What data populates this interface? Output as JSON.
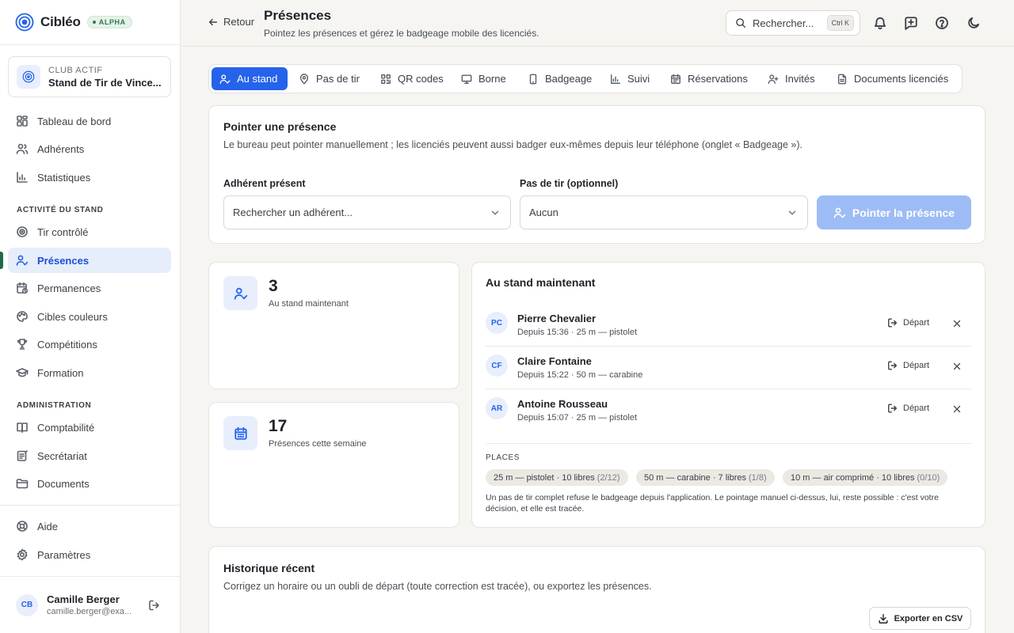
{
  "brand": {
    "name": "Cibléo",
    "badge": "ALPHA"
  },
  "club": {
    "label": "CLUB ACTIF",
    "name": "Stand de Tir de Vince..."
  },
  "sidebar": {
    "main": [
      {
        "label": "Tableau de bord",
        "icon": "dashboard-icon"
      },
      {
        "label": "Adhérents",
        "icon": "users-icon"
      },
      {
        "label": "Statistiques",
        "icon": "chart-icon"
      }
    ],
    "section_stand": "ACTIVITÉ DU STAND",
    "stand": [
      {
        "label": "Tir contrôlé",
        "icon": "target-icon"
      },
      {
        "label": "Présences",
        "icon": "user-check-icon",
        "active": true
      },
      {
        "label": "Permanences",
        "icon": "calendar-clock-icon"
      },
      {
        "label": "Cibles couleurs",
        "icon": "palette-icon"
      },
      {
        "label": "Compétitions",
        "icon": "trophy-icon"
      },
      {
        "label": "Formation",
        "icon": "graduation-cap-icon"
      }
    ],
    "section_admin": "ADMINISTRATION",
    "admin": [
      {
        "label": "Comptabilité",
        "icon": "ledger-icon"
      },
      {
        "label": "Secrétariat",
        "icon": "notepad-icon"
      },
      {
        "label": "Documents",
        "icon": "folder-icon"
      }
    ],
    "bottom": [
      {
        "label": "Aide",
        "icon": "lifebuoy-icon"
      },
      {
        "label": "Paramètres",
        "icon": "gear-icon"
      }
    ]
  },
  "user": {
    "initials": "CB",
    "name": "Camille Berger",
    "email": "camille.berger@exa..."
  },
  "header": {
    "back_label": "Retour",
    "title": "Présences",
    "subtitle": "Pointez les présences et gérez le badgeage mobile des licenciés.",
    "search_label": "Rechercher...",
    "search_shortcut": "Ctrl K"
  },
  "tabs": [
    {
      "label": "Au stand",
      "icon": "user-check-icon",
      "active": true
    },
    {
      "label": "Pas de tir",
      "icon": "map-pin-icon"
    },
    {
      "label": "QR codes",
      "icon": "qr-code-icon"
    },
    {
      "label": "Borne",
      "icon": "monitor-icon"
    },
    {
      "label": "Badgeage",
      "icon": "smartphone-icon"
    },
    {
      "label": "Suivi",
      "icon": "bar-chart-icon"
    },
    {
      "label": "Réservations",
      "icon": "calendar-icon"
    },
    {
      "label": "Invités",
      "icon": "user-plus-icon"
    },
    {
      "label": "Documents licenciés",
      "icon": "file-icon"
    }
  ],
  "pointer": {
    "title": "Pointer une présence",
    "description": "Le bureau peut pointer manuellement ; les licenciés peuvent aussi badger eux-mêmes depuis leur téléphone (onglet « Badgeage »).",
    "member_label": "Adhérent présent",
    "member_placeholder": "Rechercher un adhérent...",
    "lane_label": "Pas de tir (optionnel)",
    "lane_value": "Aucun",
    "submit_label": "Pointer la présence"
  },
  "stats": [
    {
      "value": "3",
      "label": "Au stand maintenant",
      "icon": "user-check-icon"
    },
    {
      "value": "17",
      "label": "Présences cette semaine",
      "icon": "calendar-icon"
    }
  ],
  "now": {
    "title": "Au stand maintenant",
    "depart_label": "Départ",
    "rows": [
      {
        "initials": "PC",
        "name": "Pierre Chevalier",
        "meta": "Depuis 15:36 · 25 m — pistolet"
      },
      {
        "initials": "CF",
        "name": "Claire Fontaine",
        "meta": "Depuis 15:22 · 50 m — carabine"
      },
      {
        "initials": "AR",
        "name": "Antoine Rousseau",
        "meta": "Depuis 15:07 · 25 m — pistolet"
      }
    ],
    "places_title": "PLACES",
    "places": [
      {
        "label": "25 m — pistolet · 10 libres",
        "count": "(2/12)"
      },
      {
        "label": "50 m — carabine · 7 libres",
        "count": "(1/8)"
      },
      {
        "label": "10 m — air comprimé · 10 libres",
        "count": "(0/10)"
      }
    ],
    "note": "Un pas de tir complet refuse le badgeage depuis l'application. Le pointage manuel ci-dessus, lui, reste possible : c'est votre décision, et elle est tracée."
  },
  "history": {
    "title": "Historique récent",
    "description": "Corrigez un horaire ou un oubli de départ (toute correction est tracée), ou exportez les présences.",
    "export_label": "Exporter en CSV"
  }
}
